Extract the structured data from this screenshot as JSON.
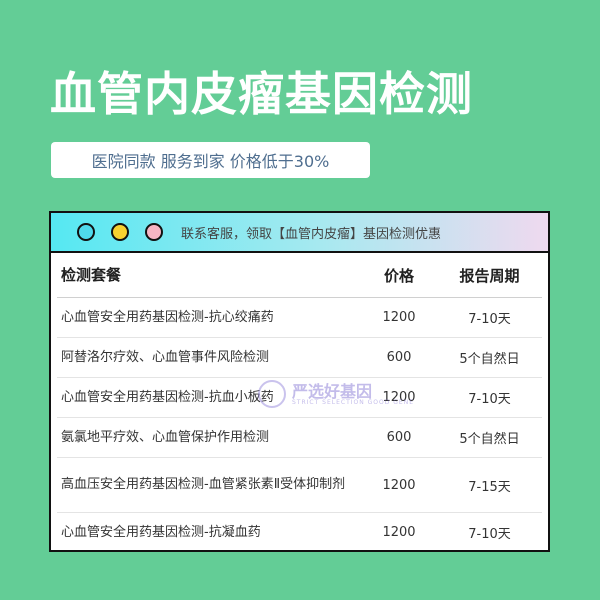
{
  "page": {
    "title": "血管内皮瘤基因检测",
    "subtitle": "医院同款 服务到家 价格低于30%"
  },
  "window": {
    "titlebar_text": "联系客服，领取【血管内皮瘤】基因检测优惠"
  },
  "table": {
    "headers": [
      "检测套餐",
      "价格",
      "报告周期"
    ],
    "rows": [
      {
        "name": "心血管安全用药基因检测-抗心绞痛药",
        "price": "1200",
        "period": "7-10天"
      },
      {
        "name": "阿替洛尔疗效、心血管事件风险检测",
        "price": "600",
        "period": "5个自然日"
      },
      {
        "name": "心血管安全用药基因检测-抗血小板药",
        "price": "1200",
        "period": "7-10天"
      },
      {
        "name": "氨氯地平疗效、心血管保护作用检测",
        "price": "600",
        "period": "5个自然日"
      },
      {
        "name": "高血压安全用药基因检测-血管紧张素Ⅱ受体抑制剂",
        "price": "1200",
        "period": "7-15天"
      },
      {
        "name": "心血管安全用药基因检测-抗凝血药",
        "price": "1200",
        "period": "7-10天"
      }
    ]
  },
  "watermark": {
    "text": "严选好基因",
    "sub": "STRICT SELECTION GOOD GENE"
  },
  "colors": {
    "background": "#63cd96",
    "subtitle_text": "#4f6e8f",
    "dot_red": "#f6b5c4",
    "dot_yellow": "#f7d130",
    "dot_cyan": "#4fd9ec"
  }
}
